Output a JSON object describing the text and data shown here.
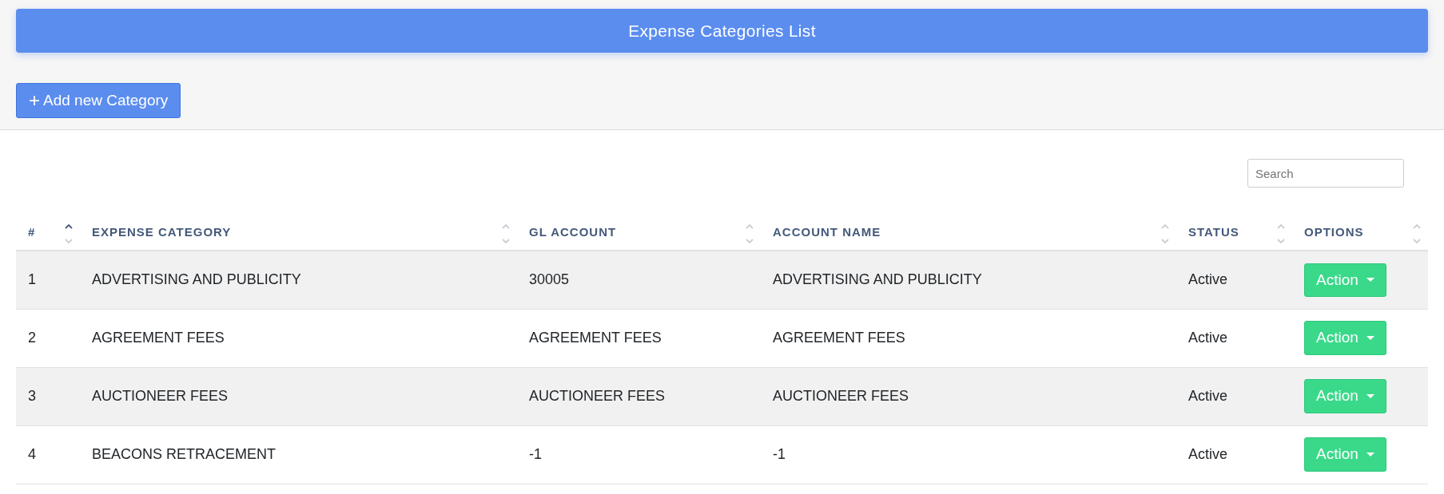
{
  "title": "Expense Categories List",
  "add_button": {
    "icon": "+",
    "label": "Add new Category"
  },
  "search": {
    "placeholder": "Search"
  },
  "table": {
    "columns": [
      {
        "label": "#",
        "sorted": true
      },
      {
        "label": "EXPENSE CATEGORY",
        "sorted": false
      },
      {
        "label": "GL ACCOUNT",
        "sorted": false
      },
      {
        "label": "ACCOUNT NAME",
        "sorted": false
      },
      {
        "label": "STATUS",
        "sorted": false
      },
      {
        "label": "OPTIONS",
        "sorted": false
      }
    ],
    "rows": [
      {
        "cells": [
          "1",
          "ADVERTISING AND PUBLICITY",
          "30005",
          "ADVERTISING AND PUBLICITY",
          "Active"
        ],
        "action": "Action"
      },
      {
        "cells": [
          "2",
          "AGREEMENT FEES",
          "AGREEMENT FEES",
          "AGREEMENT FEES",
          "Active"
        ],
        "action": "Action"
      },
      {
        "cells": [
          "3",
          "AUCTIONEER FEES",
          "AUCTIONEER FEES",
          "AUCTIONEER FEES",
          "Active"
        ],
        "action": "Action"
      },
      {
        "cells": [
          "4",
          "BEACONS RETRACEMENT",
          "-1",
          "-1",
          "Active"
        ],
        "action": "Action"
      }
    ]
  }
}
